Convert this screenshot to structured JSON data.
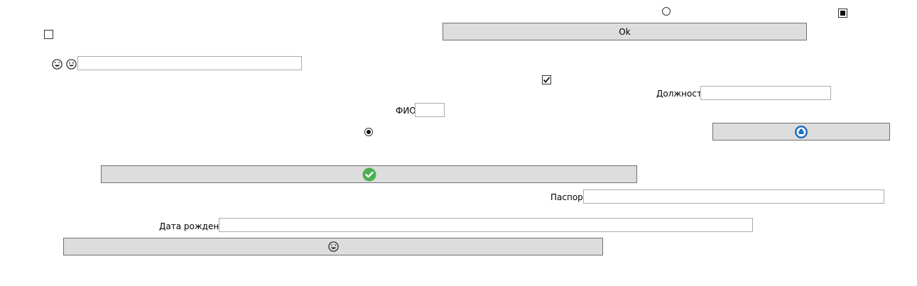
{
  "buttons": {
    "ok_label": "Ok",
    "stop_icon": "stop-hand-icon",
    "confirm_icon": "green-check-icon",
    "emoji_icon": "laughing-emoji-icon"
  },
  "labels": {
    "position": "Должность",
    "fio": "ФИО",
    "passport": "Паспорт",
    "birth_date": "Дата рождения"
  },
  "fields": {
    "emoji_text_value": "",
    "position_value": "",
    "fio_value": "",
    "passport_value": "",
    "birth_date_value": ""
  },
  "controls": {
    "radio_top_checked": false,
    "radio_mid_checked": true,
    "checkbox_left_checked": false,
    "checkbox_top_right_state": "indeterminate",
    "checkbox_mid_checked": true
  },
  "icons": [
    "laughing-emoji-icon",
    "grinning-emoji-icon",
    "green-check-icon",
    "stop-hand-icon"
  ],
  "colors": {
    "button_bg": "#dddddd",
    "check_green": "#4caf50",
    "stop_blue": "#1e6fbf"
  }
}
